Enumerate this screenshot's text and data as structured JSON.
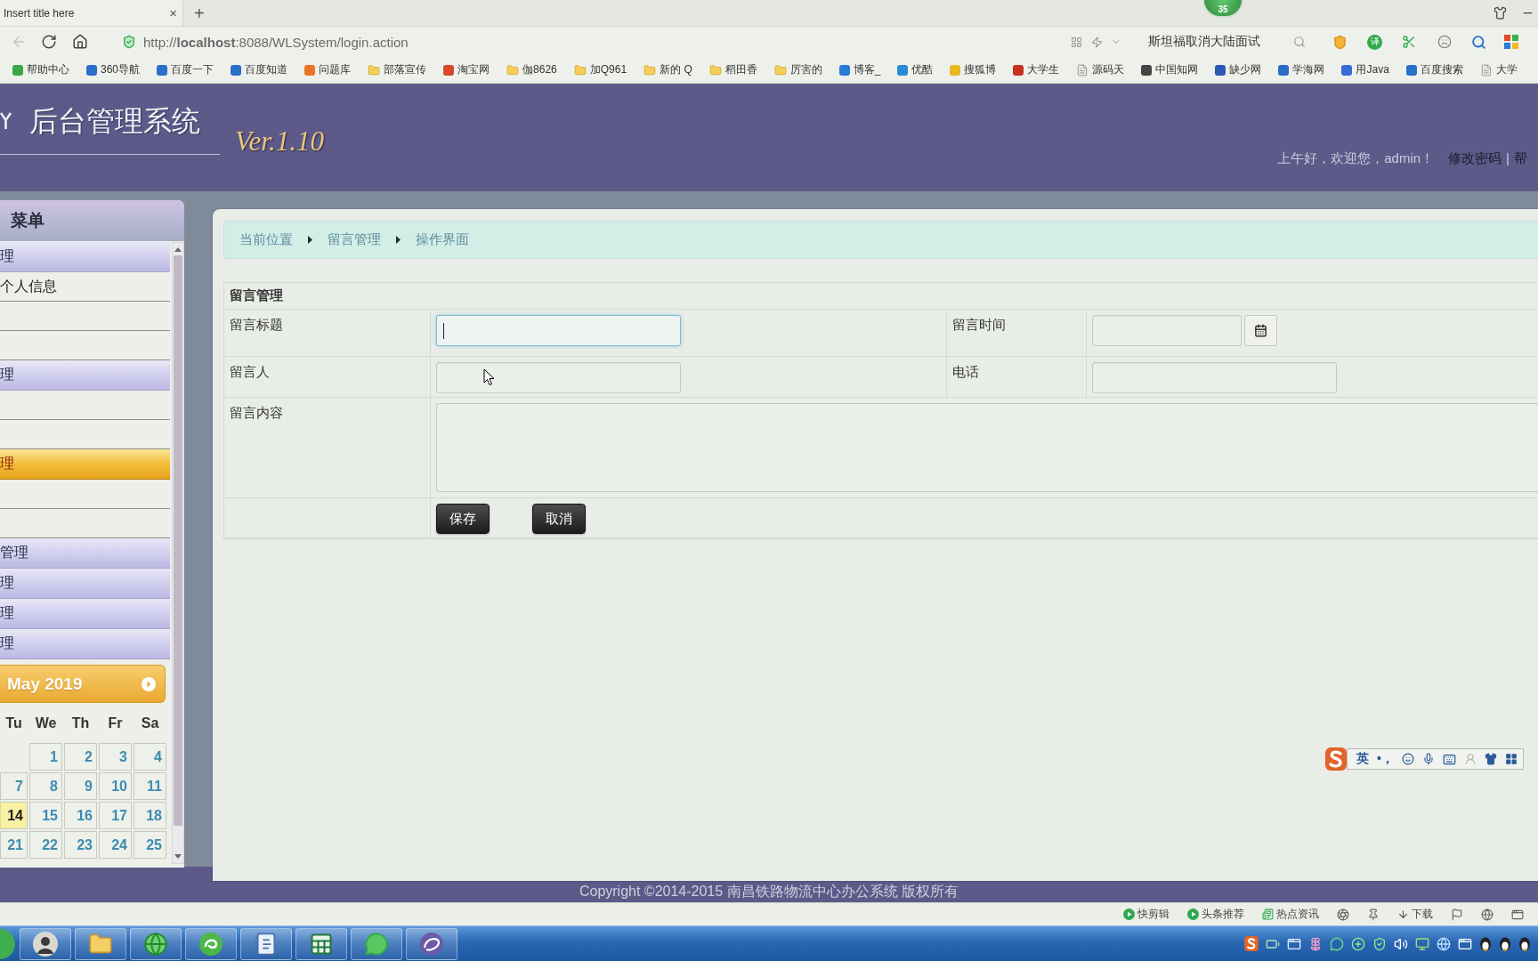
{
  "browser": {
    "tab": {
      "title": "Insert title here",
      "close": "×"
    },
    "new_tab": "+",
    "badge": "35",
    "address": "http://**localhost**:8088/WLSystem/login.action",
    "search": {
      "value": "斯坦福取消大陆面试"
    },
    "translate": "译",
    "bookmarks": [
      {
        "label": "帮助中心",
        "kind": "site",
        "color": "#3aa84a"
      },
      {
        "label": "360导航",
        "kind": "site",
        "color": "#2a6fc8"
      },
      {
        "label": "百度一下",
        "kind": "site",
        "color": "#2a6fc8"
      },
      {
        "label": "百度知道",
        "kind": "site",
        "color": "#2a6fc8"
      },
      {
        "label": "问题库",
        "kind": "site",
        "color": "#e8742a"
      },
      {
        "label": "部落宣传",
        "kind": "folder"
      },
      {
        "label": "淘宝网",
        "kind": "site",
        "color": "#d8482a"
      },
      {
        "label": "伽8626",
        "kind": "folder"
      },
      {
        "label": "加Q961",
        "kind": "folder"
      },
      {
        "label": "新的 Q",
        "kind": "folder"
      },
      {
        "label": "稻田香",
        "kind": "folder"
      },
      {
        "label": "厉害的",
        "kind": "folder"
      },
      {
        "label": "博客_",
        "kind": "site",
        "color": "#2a7ad8"
      },
      {
        "label": "优酷",
        "kind": "site",
        "color": "#2a8ad8"
      },
      {
        "label": "搜狐博",
        "kind": "site",
        "color": "#e8b820"
      },
      {
        "label": "大学生",
        "kind": "site",
        "color": "#c83020"
      },
      {
        "label": "源码天",
        "kind": "page"
      },
      {
        "label": "中国知网",
        "kind": "site",
        "color": "#444444"
      },
      {
        "label": "缺少网",
        "kind": "site",
        "color": "#2a5ab8"
      },
      {
        "label": "学海网",
        "kind": "site",
        "color": "#2a6ac8"
      },
      {
        "label": "用Java",
        "kind": "site",
        "color": "#3a6ad8"
      },
      {
        "label": "百度搜索",
        "kind": "site",
        "color": "#2a6fc8"
      },
      {
        "label": "大学",
        "kind": "page"
      }
    ]
  },
  "header": {
    "title": "后台管理系统",
    "version": "Ver.1.10",
    "greeting": "上午好，欢迎您，admin！",
    "links": [
      "修改密码",
      "帮"
    ],
    "separator": "|"
  },
  "sidebar": {
    "title": "菜单",
    "sections": [
      {
        "label": "理",
        "selected": false,
        "items": [
          {
            "kind": "entry",
            "label": "个人信息"
          },
          {
            "kind": "blank"
          },
          {
            "kind": "blank"
          }
        ]
      },
      {
        "label": "理",
        "selected": false,
        "items": [
          {
            "kind": "blank"
          },
          {
            "kind": "blank"
          }
        ]
      },
      {
        "label": "理",
        "selected": true,
        "items": [
          {
            "kind": "blank"
          },
          {
            "kind": "blank"
          }
        ]
      },
      {
        "label": "管理",
        "selected": false
      },
      {
        "label": "理",
        "selected": false
      },
      {
        "label": "理",
        "selected": false
      },
      {
        "label": "理",
        "selected": false
      }
    ],
    "calendar": {
      "month": "May 2019",
      "weekdays": [
        "Tu",
        "We",
        "Th",
        "Fr",
        "Sa"
      ],
      "weeks": [
        [
          {
            "kind": "blank"
          },
          {
            "kind": "day",
            "day": "1",
            "today": false
          },
          {
            "kind": "day",
            "day": "2",
            "today": false
          },
          {
            "kind": "day",
            "day": "3",
            "today": false
          },
          {
            "kind": "day",
            "day": "4",
            "today": false
          }
        ],
        [
          {
            "kind": "day",
            "day": "7",
            "today": false
          },
          {
            "kind": "day",
            "day": "8",
            "today": false
          },
          {
            "kind": "day",
            "day": "9",
            "today": false
          },
          {
            "kind": "day",
            "day": "10",
            "today": false
          },
          {
            "kind": "day",
            "day": "11",
            "today": false
          }
        ],
        [
          {
            "kind": "day",
            "day": "14",
            "today": true
          },
          {
            "kind": "day",
            "day": "15",
            "today": false
          },
          {
            "kind": "day",
            "day": "16",
            "today": false
          },
          {
            "kind": "day",
            "day": "17",
            "today": false
          },
          {
            "kind": "day",
            "day": "18",
            "today": false
          }
        ],
        [
          {
            "kind": "day",
            "day": "21",
            "today": false
          },
          {
            "kind": "day",
            "day": "22",
            "today": false
          },
          {
            "kind": "day",
            "day": "23",
            "today": false
          },
          {
            "kind": "day",
            "day": "24",
            "today": false
          },
          {
            "kind": "day",
            "day": "25",
            "today": false
          }
        ]
      ]
    }
  },
  "breadcrumb": [
    "当前位置",
    "留言管理",
    "操作界面"
  ],
  "form": {
    "title": "留言管理",
    "rows": [
      {
        "cells": [
          {
            "kind": "label",
            "text": "留言标题"
          },
          {
            "kind": "input",
            "focused": true
          },
          {
            "kind": "label",
            "text": "留言时间"
          },
          {
            "kind": "date"
          }
        ]
      },
      {
        "cells": [
          {
            "kind": "label",
            "text": "留言人"
          },
          {
            "kind": "input",
            "focused": false
          },
          {
            "kind": "label",
            "text": "电话"
          },
          {
            "kind": "input",
            "focused": false
          }
        ]
      },
      {
        "cells": [
          {
            "kind": "label",
            "text": "留言内容"
          },
          {
            "kind": "textarea"
          }
        ]
      },
      {
        "cells": [
          {
            "kind": "empty"
          },
          {
            "kind": "buttons",
            "buttons": [
              "保存",
              "取消"
            ]
          }
        ]
      }
    ]
  },
  "footer": {
    "copyright": "Copyright ©2014-2015 南昌铁路物流中心办公系统 版权所有"
  },
  "ime": {
    "mode": "英",
    "punctuation": "•，"
  },
  "status_bar": {
    "items": [
      {
        "kind": "play",
        "label": "快剪辑"
      },
      {
        "kind": "play",
        "label": "头条推荐"
      },
      {
        "kind": "news",
        "label": "热点资讯"
      },
      {
        "kind": "aperture"
      },
      {
        "kind": "pin"
      },
      {
        "kind": "download",
        "label": "下载"
      },
      {
        "kind": "flag"
      },
      {
        "kind": "globe"
      },
      {
        "kind": "window"
      }
    ]
  }
}
